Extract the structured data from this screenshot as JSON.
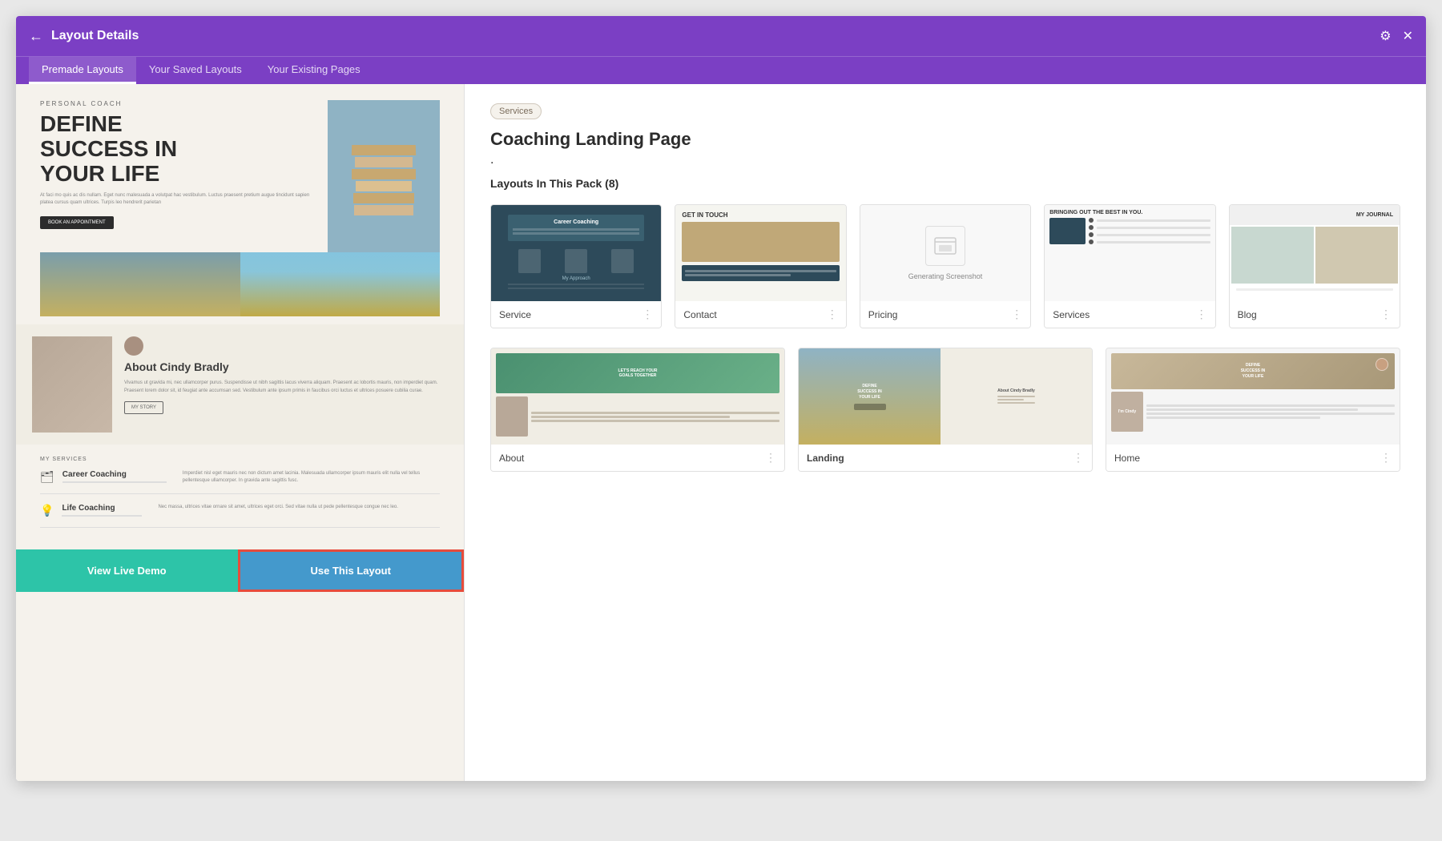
{
  "window": {
    "title": "Layout Details"
  },
  "title_bar": {
    "title": "Layout Details",
    "close_label": "✕",
    "settings_label": "⚙"
  },
  "tabs": [
    {
      "label": "Premade Layouts",
      "active": true
    },
    {
      "label": "Your Saved Layouts",
      "active": false
    },
    {
      "label": "Your Existing Pages",
      "active": false
    }
  ],
  "preview": {
    "personal_coach_label": "PERSONAL COACH",
    "hero_title": "DEFINE\nSUCCESS IN\nYOUR LIFE",
    "book_btn": "BOOK AN APPOINTMENT",
    "about_name": "About Cindy Bradly",
    "about_body": "Vivamus ut gravida mi, nec ullamcorper purus. Suspendisse ut nibh sagittis lacus viverra aliquam. Praesent ac lobortis mauris, non imperdiet quam. Praesent lorem dolor sit, id feugiat ante accumsan sed. Vestibulum ante ipsum primis in faucibus orci luctus et ultrices posuere cubilia curae.",
    "my_story_btn": "MY STORY",
    "services_label": "MY SERVICES",
    "services": [
      {
        "icon": "🗂",
        "name": "Career Coaching",
        "desc": "Imperdiet nisl eget mauris nec non dictum amet lacinia. Malesuada ullamcorper ipsum mauris elit nulla vel tellus pellentesque ullamcorper. In gravida ante sagittis fusc."
      },
      {
        "icon": "💡",
        "name": "Life Coaching",
        "desc": "Nec massa, ultrices vitae ornare sit amet, ultrices eget orci. Sed vitae nulla ut pede pellentesque congue nec leo."
      }
    ]
  },
  "right_panel": {
    "badge": "Services",
    "title": "Coaching Landing Page",
    "dot": ".",
    "layouts_count_label": "Layouts In This Pack (8)"
  },
  "layout_cards_row1": [
    {
      "name": "Service",
      "bold": false,
      "thumb_type": "service"
    },
    {
      "name": "Contact",
      "bold": false,
      "thumb_type": "contact"
    },
    {
      "name": "Pricing",
      "bold": false,
      "thumb_type": "pricing"
    },
    {
      "name": "Services",
      "bold": false,
      "thumb_type": "services"
    },
    {
      "name": "Blog",
      "bold": false,
      "thumb_type": "blog"
    }
  ],
  "layout_cards_row2": [
    {
      "name": "About",
      "bold": false,
      "thumb_type": "about"
    },
    {
      "name": "Landing",
      "bold": true,
      "thumb_type": "landing"
    },
    {
      "name": "Home",
      "bold": false,
      "thumb_type": "home"
    }
  ],
  "buttons": {
    "live_demo": "View Live Demo",
    "use_layout": "Use This Layout"
  }
}
